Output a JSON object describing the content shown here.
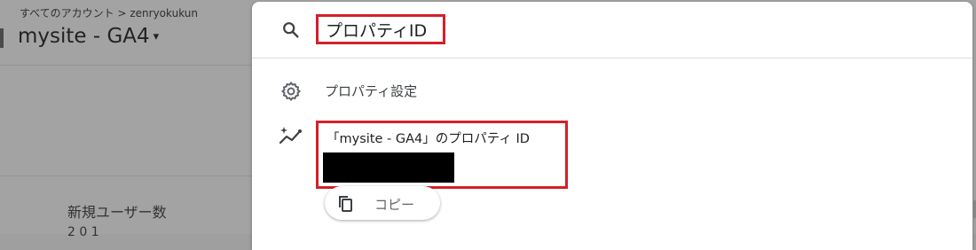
{
  "background": {
    "breadcrumb": "すべてのアカウント > zenryokukun",
    "property_title": "mysite - GA4",
    "property_caret": "▾",
    "metric_label": "新規ユーザー数",
    "metric_value": "2 0 1"
  },
  "search": {
    "query": "プロパティID",
    "placeholder": ""
  },
  "results": {
    "settings_label": "プロパティ設定",
    "property_id_label": "「mysite - GA4」のプロパティ ID",
    "property_id_value": "",
    "copy_label": "コピー"
  },
  "colors": {
    "highlight_border": "#d32029",
    "panel": "#ffffff",
    "overlay": "#a3a3a3",
    "icon": "#5f6368"
  },
  "icons": [
    "search-icon",
    "gear-icon",
    "sparkle-chart-icon",
    "copy-icon"
  ]
}
